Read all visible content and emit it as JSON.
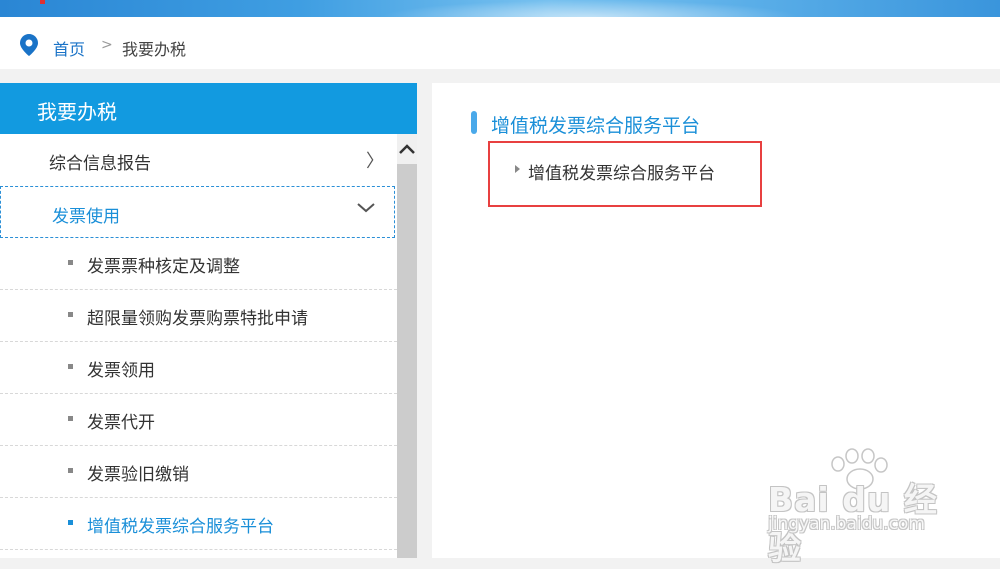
{
  "breadcrumb": {
    "home": "首页",
    "separator": ">",
    "current": "我要办税"
  },
  "sidebar": {
    "title": "我要办税",
    "top_item": {
      "label": "综合信息报告",
      "chevron": "〉"
    },
    "active_item": {
      "label": "发票使用"
    },
    "sub_items": [
      {
        "label": "发票票种核定及调整"
      },
      {
        "label": "超限量领购发票购票特批申请"
      },
      {
        "label": "发票领用"
      },
      {
        "label": "发票代开"
      },
      {
        "label": "发票验旧缴销"
      },
      {
        "label": "增值税发票综合服务平台"
      }
    ]
  },
  "content": {
    "title": "增值税发票综合服务平台",
    "link": "增值税发票综合服务平台"
  },
  "watermark": {
    "logo": "Bai du 经验",
    "url": "jingyan.baidu.com"
  },
  "colors": {
    "accent": "#129ae0",
    "link_blue": "#1a8fd8",
    "highlight_red": "#e84040"
  }
}
